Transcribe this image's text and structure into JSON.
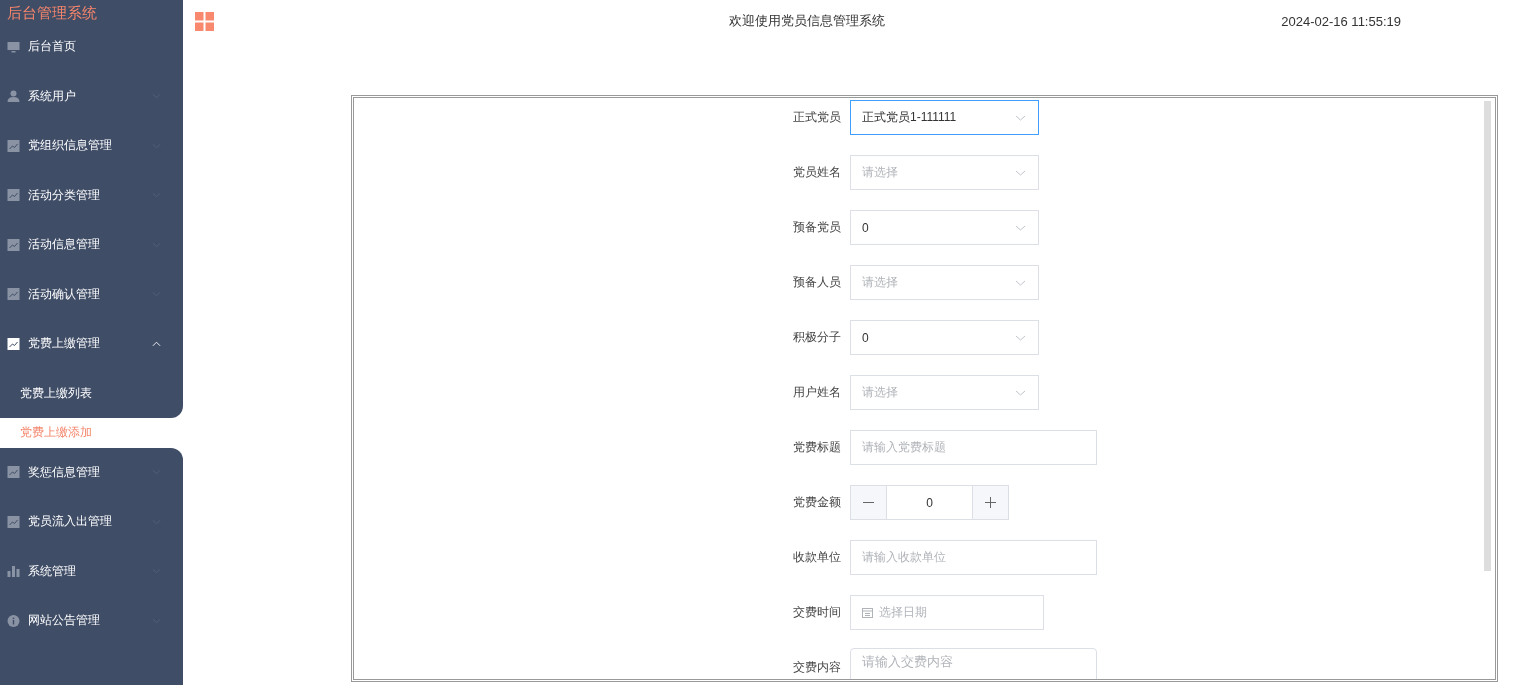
{
  "sidebar": {
    "title": "后台管理系统",
    "items": [
      {
        "label": "后台首页"
      },
      {
        "label": "系统用户",
        "expanded": false
      },
      {
        "label": "党组织信息管理",
        "expanded": false
      },
      {
        "label": "活动分类管理",
        "expanded": false
      },
      {
        "label": "活动信息管理",
        "expanded": false
      },
      {
        "label": "活动确认管理",
        "expanded": false
      },
      {
        "label": "党费上缴管理",
        "expanded": true,
        "children": [
          {
            "label": "党费上缴列表",
            "selected": false
          },
          {
            "label": "党费上缴添加",
            "selected": true
          }
        ]
      },
      {
        "label": "奖惩信息管理",
        "expanded": false
      },
      {
        "label": "党员流入出管理",
        "expanded": false
      },
      {
        "label": "系统管理",
        "expanded": false
      },
      {
        "label": "网站公告管理",
        "expanded": false
      }
    ]
  },
  "header": {
    "title": "欢迎使用党员信息管理系统",
    "time": "2024-02-16 11:55:19"
  },
  "form": {
    "fields": [
      {
        "label": "正式党员",
        "kind": "select",
        "value": "正式党员1-111111",
        "focused": true
      },
      {
        "label": "党员姓名",
        "kind": "select",
        "placeholder": "请选择",
        "focused": false
      },
      {
        "label": "预备党员",
        "kind": "select",
        "value": "0",
        "focused": false
      },
      {
        "label": "预备人员",
        "kind": "select",
        "placeholder": "请选择",
        "focused": false
      },
      {
        "label": "积极分子",
        "kind": "select",
        "value": "0",
        "focused": false
      },
      {
        "label": "用户姓名",
        "kind": "select",
        "placeholder": "请选择",
        "focused": false
      },
      {
        "label": "党费标题",
        "kind": "text",
        "placeholder": "请输入党费标题",
        "focused": false
      },
      {
        "label": "党费金额",
        "kind": "number",
        "value": "0",
        "focused": false
      },
      {
        "label": "收款单位",
        "kind": "text",
        "placeholder": "请输入收款单位",
        "focused": false
      },
      {
        "label": "交费时间",
        "kind": "date",
        "placeholder": "选择日期",
        "focused": false
      },
      {
        "label": "交费内容",
        "kind": "textarea",
        "placeholder": "请输入交费内容",
        "focused": false
      }
    ]
  }
}
